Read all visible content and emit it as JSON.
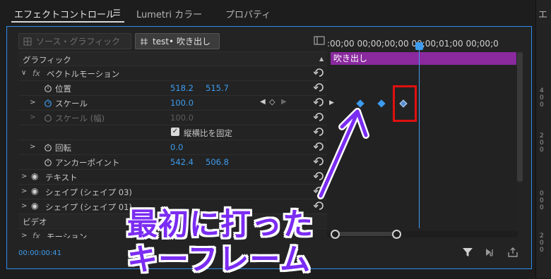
{
  "tabs": [
    {
      "label": "エフェクトコントロール",
      "active": true
    },
    {
      "label": "Lumetri カラー",
      "active": false
    },
    {
      "label": "プロパティ",
      "active": false
    }
  ],
  "right_panel": {
    "header": "エ",
    "numbers": [
      "4",
      "0",
      "0",
      "2",
      "0",
      "0",
      "0",
      "0",
      "0",
      "2",
      "0",
      "0"
    ]
  },
  "source": {
    "inactive_label": "ソース・グラフィック",
    "active_label": "test• 吹き出し"
  },
  "timeline": {
    "ruler_text": ":00;00 00;00;00;00 00;00;01;00 00;00;0",
    "clip_label": "吹き出し"
  },
  "properties": {
    "graphic_header": "グラフィック",
    "vector_motion": "ベクトルモーション",
    "fx": "fx",
    "position": {
      "label": "位置",
      "x": "518.2",
      "y": "515.7"
    },
    "scale": {
      "label": "スケール",
      "value": "100.0"
    },
    "scale_width": {
      "label": "スケール (幅)",
      "value": "100.0"
    },
    "uniform_scale": {
      "label": "縦横比を固定",
      "checked": true
    },
    "rotation": {
      "label": "回転",
      "value": "0.0"
    },
    "anchor": {
      "label": "アンカーポイント",
      "x": "542.4",
      "y": "506.8"
    },
    "text_layer": "テキスト",
    "shape1": "シェイプ (シェイプ 03)",
    "shape2": "シェイプ (シェイプ 01)",
    "video_header": "ビデオ",
    "motion": "モーション"
  },
  "timecode": "00:00:00:41",
  "annotation": {
    "line1": "最初に打った",
    "line2": "キーフレーム"
  },
  "colors": {
    "accent": "#3d9cf0",
    "clip": "#8a2a9e",
    "annotation": "#7b2cf2",
    "highlight": "#e01010"
  }
}
